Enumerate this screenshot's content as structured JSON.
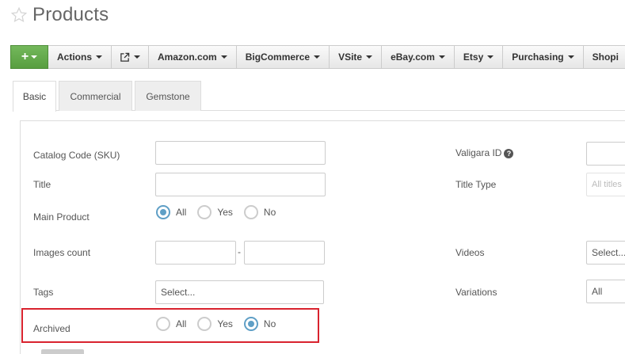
{
  "page": {
    "title": "Products",
    "star_icon": "star-outline-icon"
  },
  "toolbar": {
    "add_label": "+",
    "actions": "Actions",
    "external_icon": "external-link-icon",
    "amazon": "Amazon.com",
    "bigcommerce": "BigCommerce",
    "vsite": "VSite",
    "ebay": "eBay.com",
    "etsy": "Etsy",
    "purchasing": "Purchasing",
    "shopify": "Shopi"
  },
  "tabs": [
    {
      "label": "Basic",
      "active": true
    },
    {
      "label": "Commercial",
      "active": false
    },
    {
      "label": "Gemstone",
      "active": false
    }
  ],
  "form": {
    "catalog_code_label": "Catalog Code (SKU)",
    "catalog_code_value": "",
    "title_label": "Title",
    "title_value": "",
    "main_product_label": "Main Product",
    "main_product_options": [
      "All",
      "Yes",
      "No"
    ],
    "main_product_selected": "All",
    "images_count_label": "Images count",
    "images_count_dash": "-",
    "tags_label": "Tags",
    "tags_value": "Select...",
    "archived_label": "Archived",
    "archived_options": [
      "All",
      "Yes",
      "No"
    ],
    "archived_selected": "No",
    "valigara_id_label": "Valigara ID",
    "title_type_label": "Title Type",
    "title_type_placeholder": "All titles",
    "videos_label": "Videos",
    "videos_value": "Select...",
    "variations_label": "Variations",
    "variations_value": "All"
  },
  "colors": {
    "accent": "#5f9fc6",
    "add_button": "#68ad50",
    "highlight": "#d9232e"
  }
}
